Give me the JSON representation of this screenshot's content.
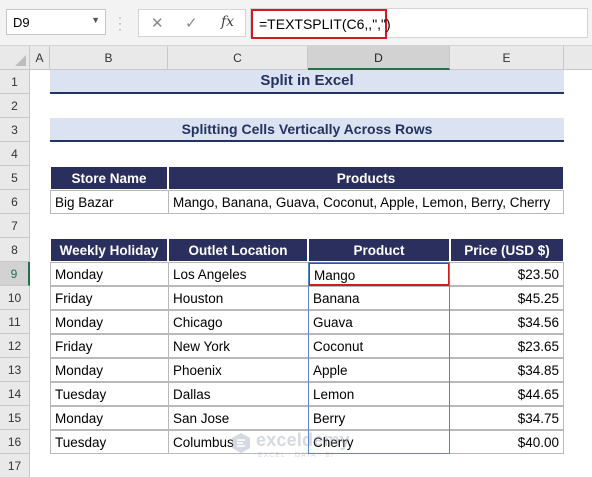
{
  "formula_bar": {
    "name_box": "D9",
    "cancel_icon": "✕",
    "enter_icon": "✓",
    "fx_label": "fx",
    "formula": "=TEXTSPLIT(C6,,\",\")"
  },
  "columns": [
    "A",
    "B",
    "C",
    "D",
    "E"
  ],
  "rows": [
    "1",
    "2",
    "3",
    "4",
    "5",
    "6",
    "7",
    "8",
    "9",
    "10",
    "11",
    "12",
    "13",
    "14",
    "15",
    "16",
    "17"
  ],
  "sheet": {
    "title": "Split in Excel",
    "subtitle": "Splitting Cells Vertically Across Rows",
    "store_table": {
      "headers": [
        "Store Name",
        "Products"
      ],
      "store": "Big Bazar",
      "products": "Mango, Banana, Guava, Coconut, Apple, Lemon, Berry, Cherry"
    },
    "main_table": {
      "headers": [
        "Weekly Holiday",
        "Outlet Location",
        "Product",
        "Price (USD $)"
      ],
      "rows": [
        [
          "Monday",
          "Los Angeles",
          "Mango",
          "$23.50"
        ],
        [
          "Friday",
          "Houston",
          "Banana",
          "$45.25"
        ],
        [
          "Monday",
          "Chicago",
          "Guava",
          "$34.56"
        ],
        [
          "Friday",
          "New York",
          "Coconut",
          "$23.65"
        ],
        [
          "Monday",
          "Phoenix",
          "Apple",
          "$34.85"
        ],
        [
          "Tuesday",
          "Dallas",
          "Lemon",
          "$44.65"
        ],
        [
          "Monday",
          "San Jose",
          "Berry",
          "$34.75"
        ],
        [
          "Tuesday",
          "Columbus",
          "Cherry",
          "$40.00"
        ]
      ]
    }
  },
  "watermark": {
    "name": "exceldemy",
    "tagline": "EXCEL · DATA · BI"
  },
  "colors": {
    "header_bg": "#2b2f5e",
    "title_bg": "#dbe2f2",
    "selection": "#d21c1c",
    "excel_green": "#217346"
  }
}
